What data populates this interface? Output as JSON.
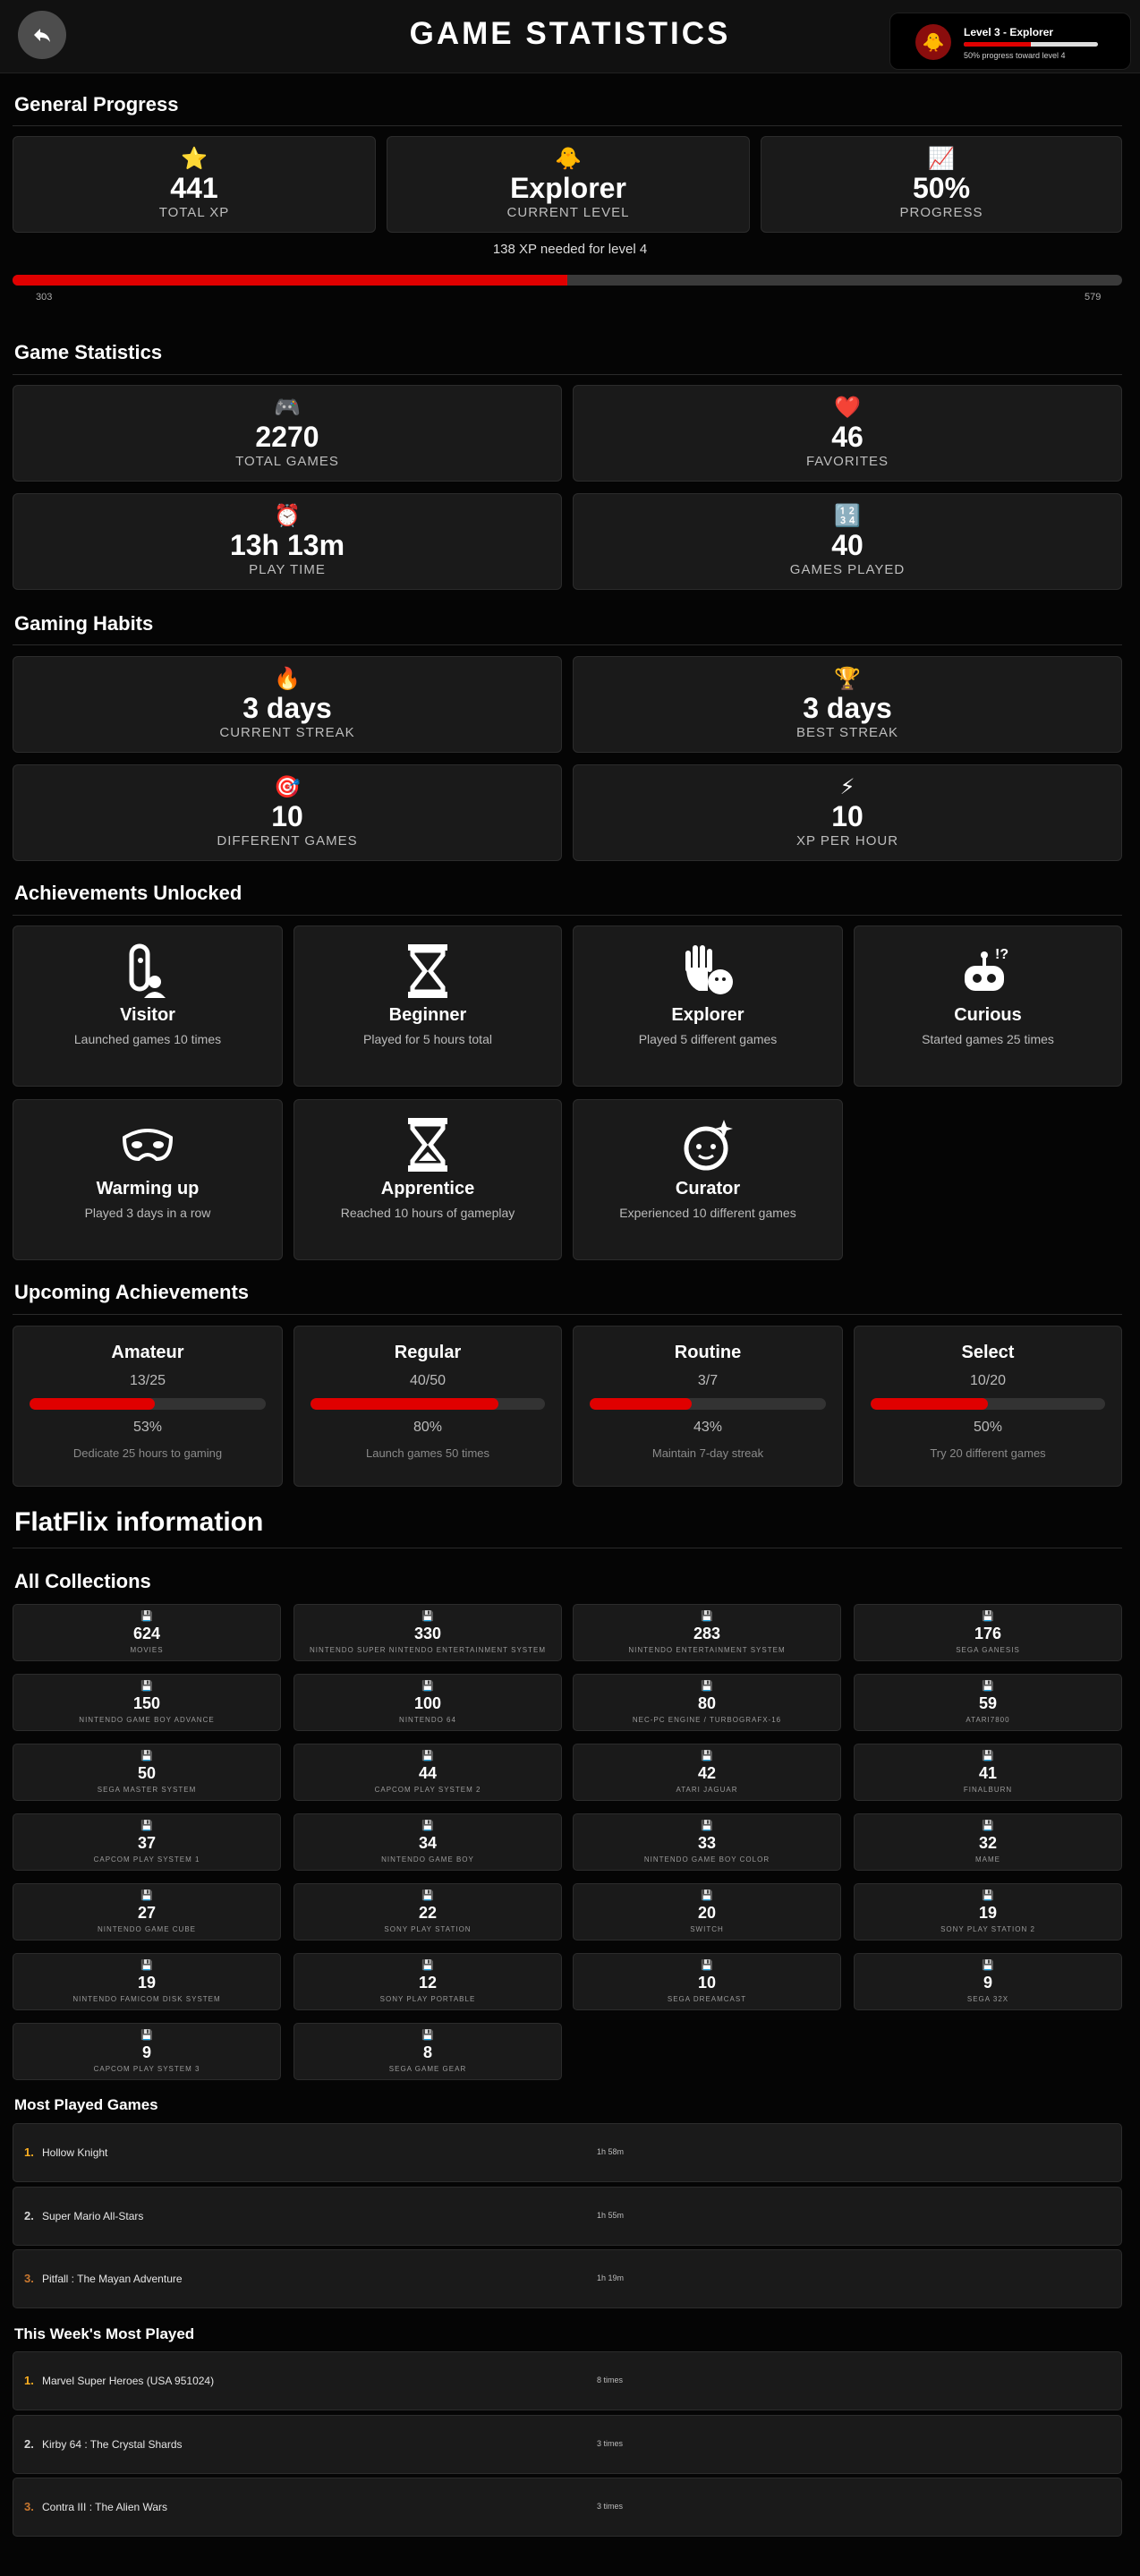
{
  "header": {
    "title": "GAME STATISTICS",
    "level_badge": {
      "name": "Level 3 - Explorer",
      "subtitle": "50% progress toward level 4",
      "progress": 0.5,
      "icon": "chick-icon"
    }
  },
  "colors": {
    "accent": "#e00000",
    "card_bg": "#1a1a1a",
    "page_bg": "#050505"
  },
  "general_progress": {
    "title": "General Progress",
    "cards": [
      {
        "icon": "⭐",
        "value": "441",
        "label": "TOTAL XP"
      },
      {
        "icon": "🐥",
        "value": "Explorer",
        "label": "CURRENT LEVEL"
      },
      {
        "icon": "📈",
        "value": "50%",
        "label": "PROGRESS"
      }
    ],
    "xp_note": "138 XP needed for level 4",
    "bar": {
      "min": "303",
      "max": "579",
      "progress": 0.5
    }
  },
  "game_statistics": {
    "title": "Game Statistics",
    "cards": [
      {
        "icon": "🎮",
        "value": "2270",
        "label": "TOTAL GAMES"
      },
      {
        "icon": "❤️",
        "value": "46",
        "label": "FAVORITES"
      },
      {
        "icon": "⏰",
        "value": "13h 13m",
        "label": "PLAY TIME"
      },
      {
        "icon": "🔢",
        "value": "40",
        "label": "GAMES PLAYED"
      }
    ]
  },
  "gaming_habits": {
    "title": "Gaming Habits",
    "cards": [
      {
        "icon": "🔥",
        "value": "3 days",
        "label": "CURRENT STREAK"
      },
      {
        "icon": "🏆",
        "value": "3 days",
        "label": "BEST STREAK"
      },
      {
        "icon": "🎯",
        "value": "10",
        "label": "DIFFERENT GAMES"
      },
      {
        "icon": "⚡",
        "value": "10",
        "label": "XP PER HOUR"
      }
    ]
  },
  "achievements": {
    "title": "Achievements Unlocked",
    "items": [
      {
        "icon": "visitor-icon",
        "name": "Visitor",
        "desc": "Launched games 10 times"
      },
      {
        "icon": "hourglass-icon",
        "name": "Beginner",
        "desc": "Played for 5 hours total"
      },
      {
        "icon": "hand-icon",
        "name": "Explorer",
        "desc": "Played 5 different games"
      },
      {
        "icon": "robot-icon",
        "name": "Curious",
        "desc": "Started games 25 times"
      },
      {
        "icon": "mask-icon",
        "name": "Warming up",
        "desc": "Played 3 days in a row"
      },
      {
        "icon": "hourglass-icon",
        "name": "Apprentice",
        "desc": "Reached 10 hours of gameplay"
      },
      {
        "icon": "sparkle-face-icon",
        "name": "Curator",
        "desc": "Experienced 10 different games"
      }
    ]
  },
  "upcoming": {
    "title": "Upcoming Achievements",
    "items": [
      {
        "name": "Amateur",
        "count": "13/25",
        "pct": "53%",
        "progress": 0.53,
        "desc": "Dedicate 25 hours to gaming"
      },
      {
        "name": "Regular",
        "count": "40/50",
        "pct": "80%",
        "progress": 0.8,
        "desc": "Launch games 50 times"
      },
      {
        "name": "Routine",
        "count": "3/7",
        "pct": "43%",
        "progress": 0.43,
        "desc": "Maintain 7-day streak"
      },
      {
        "name": "Select",
        "count": "10/20",
        "pct": "50%",
        "progress": 0.5,
        "desc": "Try 20 different games"
      }
    ]
  },
  "flatflix": {
    "title": "FlatFlix information",
    "collections_title": "All Collections",
    "collections": [
      {
        "count": "624",
        "label": "MOVIES"
      },
      {
        "count": "330",
        "label": "NINTENDO SUPER NINTENDO ENTERTAINMENT SYSTEM"
      },
      {
        "count": "283",
        "label": "NINTENDO ENTERTAINMENT SYSTEM"
      },
      {
        "count": "176",
        "label": "SEGA GANESIS"
      },
      {
        "count": "150",
        "label": "NINTENDO GAME BOY ADVANCE"
      },
      {
        "count": "100",
        "label": "NINTENDO 64"
      },
      {
        "count": "80",
        "label": "NEC-PC ENGINE / TURBOGRAFX-16"
      },
      {
        "count": "59",
        "label": "ATARI7800"
      },
      {
        "count": "50",
        "label": "SEGA MASTER SYSTEM"
      },
      {
        "count": "44",
        "label": "CAPCOM PLAY SYSTEM 2"
      },
      {
        "count": "42",
        "label": "ATARI JAGUAR"
      },
      {
        "count": "41",
        "label": "FINALBURN"
      },
      {
        "count": "37",
        "label": "CAPCOM PLAY SYSTEM 1"
      },
      {
        "count": "34",
        "label": "NINTENDO GAME BOY"
      },
      {
        "count": "33",
        "label": "NINTENDO GAME BOY COLOR"
      },
      {
        "count": "32",
        "label": "MAME"
      },
      {
        "count": "27",
        "label": "NINTENDO GAME CUBE"
      },
      {
        "count": "22",
        "label": "SONY PLAY STATION"
      },
      {
        "count": "20",
        "label": "SWITCH"
      },
      {
        "count": "19",
        "label": "SONY PLAY STATION 2"
      },
      {
        "count": "19",
        "label": "NINTENDO FAMICOM DISK SYSTEM"
      },
      {
        "count": "12",
        "label": "SONY PLAY PORTABLE"
      },
      {
        "count": "10",
        "label": "SEGA DREAMCAST"
      },
      {
        "count": "9",
        "label": "SEGA 32X"
      },
      {
        "count": "9",
        "label": "CAPCOM PLAY SYSTEM 3"
      },
      {
        "count": "8",
        "label": "SEGA GAME GEAR"
      }
    ],
    "collection_icon": "💾",
    "most_played_title": "Most Played Games",
    "most_played": [
      {
        "rank": "1.",
        "name": "Hollow Knight",
        "value": "1h 58m"
      },
      {
        "rank": "2.",
        "name": "Super Mario All-Stars",
        "value": "1h 55m"
      },
      {
        "rank": "3.",
        "name": "Pitfall : The Mayan Adventure",
        "value": "1h 19m"
      }
    ],
    "weekly_title": "This Week's Most Played",
    "weekly": [
      {
        "rank": "1.",
        "name": "Marvel Super Heroes (USA 951024)",
        "value": "8 times"
      },
      {
        "rank": "2.",
        "name": "Kirby 64 : The Crystal Shards",
        "value": "3 times"
      },
      {
        "rank": "3.",
        "name": "Contra III : The Alien Wars",
        "value": "3 times"
      }
    ]
  }
}
